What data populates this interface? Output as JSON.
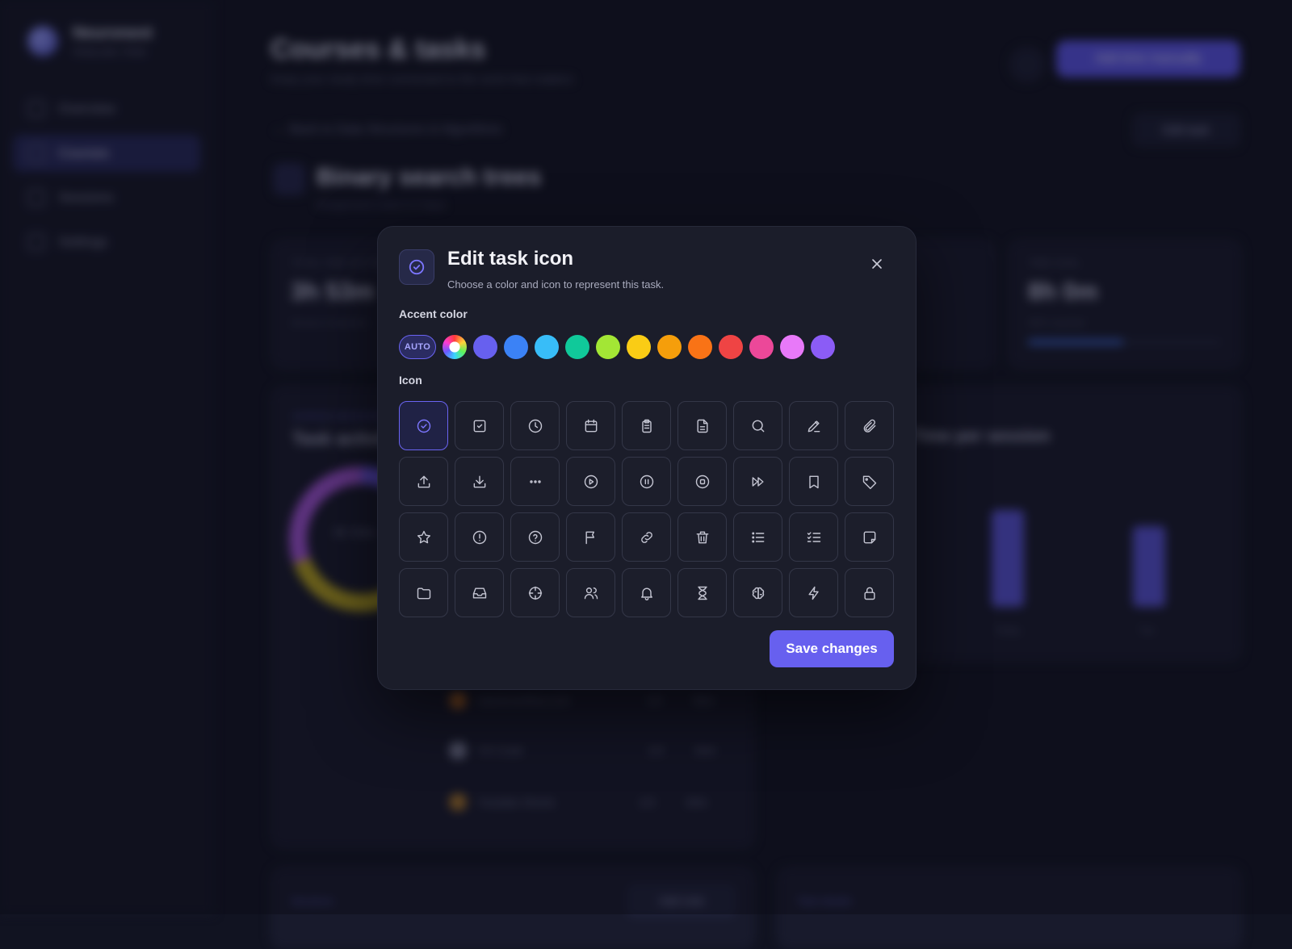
{
  "app": {
    "brand_name": "Neuronest",
    "brand_sub": "Study plan, finals",
    "nav": [
      {
        "label": "Overview"
      },
      {
        "label": "Courses"
      },
      {
        "label": "Sessions"
      },
      {
        "label": "Settings"
      }
    ],
    "page_title": "Courses & tasks",
    "page_subtitle": "Keep your study time connected to the work that matters",
    "add_button": "Add time manually",
    "back_link": "Back to Data Structures & Algorithms",
    "edit_task_button": "Edit task",
    "task_title": "Binary search trees",
    "task_subtitle": "Assignment 3 due in 5 days",
    "stats": [
      {
        "label": "TOTAL TIME ON TASK",
        "value": "3h 53m",
        "note": "Across 4 sessions"
      },
      {
        "label": "TIME GOAL",
        "value": "8h 0m",
        "note": "49% reached",
        "progress": 0.49
      }
    ],
    "task_activity_label": "ACROSS SESSIONS",
    "task_activity_title": "Task activity",
    "donut_center": "3h 53m",
    "sessions_title": "Time per session",
    "bar_labels": [
      "Today",
      "Tue"
    ],
    "rows": [
      {
        "name": "stackoverflow.com",
        "count": "1/3",
        "time": "56m"
      },
      {
        "name": "VS Code",
        "count": "1/3",
        "time": "34m"
      },
      {
        "name": "Youtube Shorts",
        "count": "1/3",
        "time": "34m"
      }
    ],
    "bottom_left": "Sessions",
    "bottom_left_btn": "Add note",
    "bottom_right": "Task details"
  },
  "modal": {
    "title": "Edit task icon",
    "subtitle": "Choose a color and icon to represent this task.",
    "accent_label": "Accent color",
    "auto_label": "AUTO",
    "colors": [
      "#6760ef",
      "#3b82f6",
      "#38bdf8",
      "#10c99a",
      "#a3e635",
      "#facc15",
      "#f59e0b",
      "#f97316",
      "#ef4444",
      "#ec4899",
      "#e879f9",
      "#8b5cf6"
    ],
    "icon_label": "Icon",
    "icons": [
      "check-circle-icon",
      "check-square-icon",
      "clock-icon",
      "calendar-icon",
      "clipboard-icon",
      "document-icon",
      "search-icon",
      "pen-icon",
      "paperclip-icon",
      "upload-icon",
      "download-icon",
      "more-horizontal-icon",
      "play-circle-icon",
      "pause-circle-icon",
      "stop-circle-icon",
      "fast-forward-icon",
      "bookmark-icon",
      "tag-icon",
      "star-icon",
      "alert-circle-icon",
      "help-circle-icon",
      "flag-icon",
      "link-icon",
      "trash-icon",
      "list-icon",
      "list-checks-icon",
      "sticky-note-icon",
      "folder-icon",
      "inbox-icon",
      "crosshair-icon",
      "users-icon",
      "bell-icon",
      "hourglass-icon",
      "brain-icon",
      "zap-icon",
      "lock-icon"
    ],
    "selected_icon": "check-circle-icon",
    "save_label": "Save changes"
  }
}
